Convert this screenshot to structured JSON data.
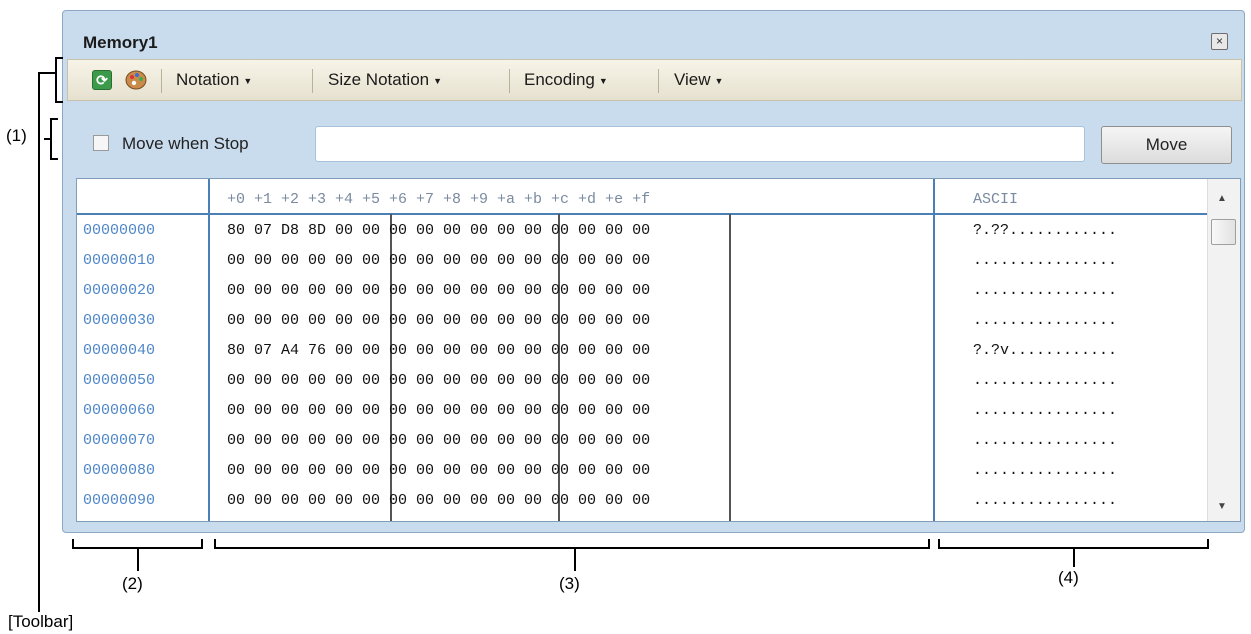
{
  "window": {
    "title": "Memory1",
    "close_glyph": "×"
  },
  "toolbar": {
    "refresh_icon": "refresh-icon",
    "palette_icon": "palette-icon",
    "menus": [
      "Notation",
      "Size Notation",
      "Encoding",
      "View"
    ]
  },
  "options": {
    "checkbox_label": "Move when Stop",
    "checkbox_checked": false,
    "address_value": "",
    "move_button_label": "Move"
  },
  "memory": {
    "offset_header": "+0 +1 +2 +3 +4 +5 +6 +7 +8 +9 +a +b +c +d +e +f",
    "ascii_header": "ASCII",
    "rows": [
      {
        "address": "00000000",
        "bytes": "80 07 D8 8D 00 00 00 00 00 00 00 00 00 00 00 00",
        "ascii": "?.??............"
      },
      {
        "address": "00000010",
        "bytes": "00 00 00 00 00 00 00 00 00 00 00 00 00 00 00 00",
        "ascii": "................"
      },
      {
        "address": "00000020",
        "bytes": "00 00 00 00 00 00 00 00 00 00 00 00 00 00 00 00",
        "ascii": "................"
      },
      {
        "address": "00000030",
        "bytes": "00 00 00 00 00 00 00 00 00 00 00 00 00 00 00 00",
        "ascii": "................"
      },
      {
        "address": "00000040",
        "bytes": "80 07 A4 76 00 00 00 00 00 00 00 00 00 00 00 00",
        "ascii": "?.?v............"
      },
      {
        "address": "00000050",
        "bytes": "00 00 00 00 00 00 00 00 00 00 00 00 00 00 00 00",
        "ascii": "................"
      },
      {
        "address": "00000060",
        "bytes": "00 00 00 00 00 00 00 00 00 00 00 00 00 00 00 00",
        "ascii": "................"
      },
      {
        "address": "00000070",
        "bytes": "00 00 00 00 00 00 00 00 00 00 00 00 00 00 00 00",
        "ascii": "................"
      },
      {
        "address": "00000080",
        "bytes": "00 00 00 00 00 00 00 00 00 00 00 00 00 00 00 00",
        "ascii": "................"
      },
      {
        "address": "00000090",
        "bytes": "00 00 00 00 00 00 00 00 00 00 00 00 00 00 00 00",
        "ascii": "................"
      }
    ]
  },
  "annotations": {
    "area1": "(1)",
    "area2": "(2)",
    "area3": "(3)",
    "area4": "(4)",
    "toolbar": "[Toolbar]"
  },
  "colors": {
    "address": "#4f87c8",
    "header": "#7a8aa0",
    "grid_line": "#4a7fb8",
    "window_bg": "#c9dcee"
  }
}
